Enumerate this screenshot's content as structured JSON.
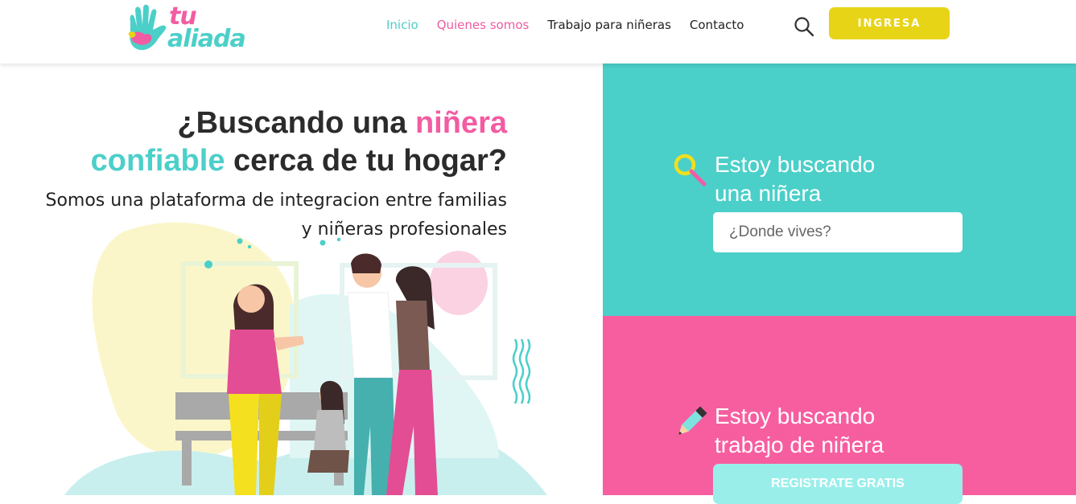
{
  "header": {
    "logo": {
      "line1": "tu",
      "line2": "aliada"
    },
    "nav": [
      {
        "label": "Inicio"
      },
      {
        "label": "Quienes somos"
      },
      {
        "label": "Trabajo para niñeras"
      },
      {
        "label": "Contacto"
      }
    ],
    "search_icon": "search-icon",
    "login_label": "INGRESA"
  },
  "hero": {
    "title_part1": "¿Buscando una ",
    "title_highlight1": "niñera",
    "title_highlight2": "confiable",
    "title_part2": " cerca de tu hogar?",
    "subtitle_line1": "Somos una plataforma de integracion entre familias",
    "subtitle_line2": "y niñeras profesionales"
  },
  "family_panel": {
    "icon": "magnifier-icon",
    "heading_line1": "Estoy buscando",
    "heading_line2": "una niñera",
    "location_placeholder": "¿Donde vives?"
  },
  "nanny_panel": {
    "icon": "pencil-icon",
    "heading_line1": "Estoy buscando",
    "heading_line2": "trabajo de niñera",
    "register_label": "REGISTRATE GRATIS"
  },
  "colors": {
    "teal": "#4bcfc9",
    "pink": "#f75ea0",
    "yellow": "#e8d417",
    "text": "#2b2b2b"
  }
}
